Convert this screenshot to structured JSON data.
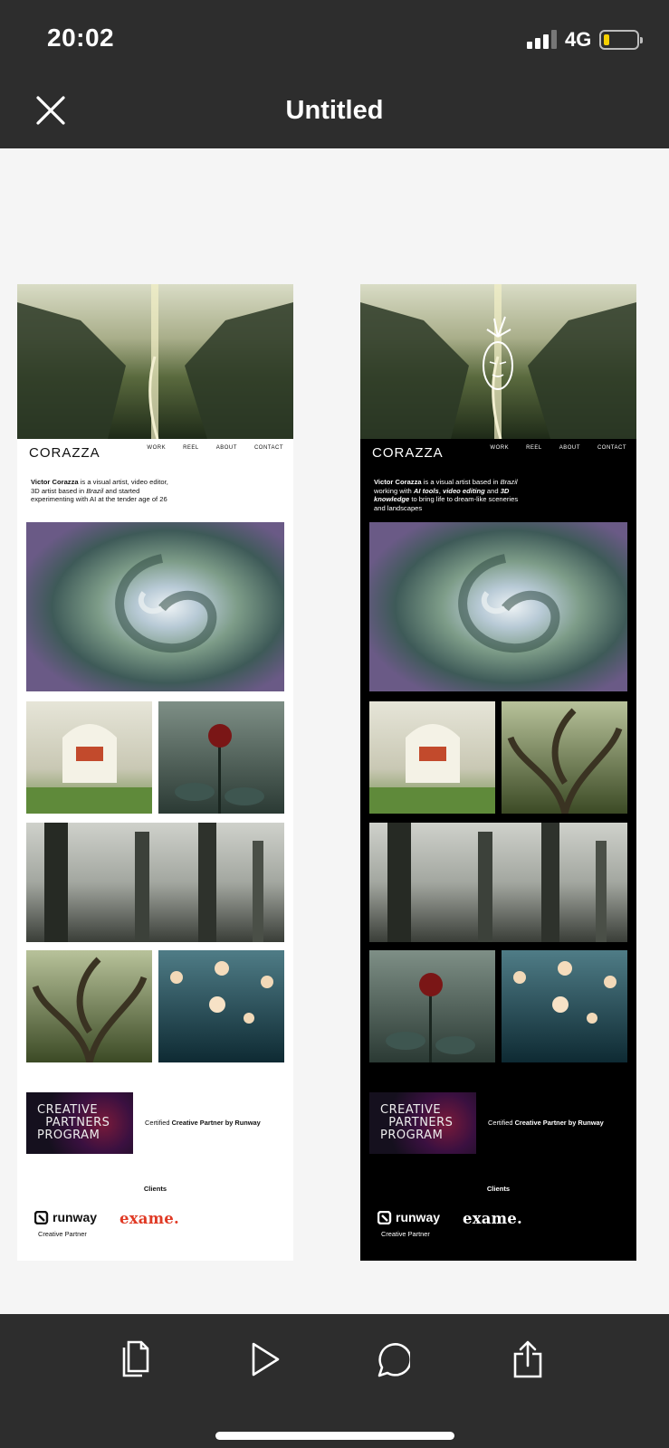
{
  "status_bar": {
    "time": "20:02",
    "network": "4G",
    "battery_color": "#f5d000"
  },
  "nav": {
    "title": "Untitled",
    "close_icon": "close-icon"
  },
  "pages": {
    "light": {
      "brand": "CORAZZA",
      "menu": [
        "WORK",
        "REEL",
        "ABOUT",
        "CONTACT"
      ],
      "bio": {
        "name": "Victor Corazza",
        "t1": " is a visual artist, video editor, 3D artist based in ",
        "country": "Brazil",
        "t2": " and started experimenting with AI at the tender age of 26"
      },
      "partner_box": "CREATIVE\n  PARTNERS\nPROGRAM",
      "cert_prefix": "Certified ",
      "cert_bold": "Creative Partner by Runway",
      "clients_title": "Clients",
      "runway_name": "runway",
      "runway_sub": "Creative Partner",
      "exame": "exame."
    },
    "dark": {
      "brand": "CORAZZA",
      "menu": [
        "WORK",
        "REEL",
        "ABOUT",
        "CONTACT"
      ],
      "bio": {
        "name": "Victor Corazza",
        "t1": " is a visual artist based in ",
        "country": "Brazil",
        "t2": " working with ",
        "b1": "AI tools",
        "t3": ", ",
        "b2": "video editing",
        "t4": " and ",
        "b3": "3D knowledge",
        "t5": " to bring life to dream-like sceneries and landscapes"
      },
      "partner_box": "CREATIVE\n  PARTNERS\nPROGRAM",
      "cert_prefix": "Certified ",
      "cert_bold": "Creative Partner by Runway",
      "clients_title": "Clients",
      "runway_name": "runway",
      "runway_sub": "Creative Partner",
      "exame": "exame."
    }
  },
  "toolbar": {
    "icons": [
      "copy-icon",
      "play-icon",
      "comment-icon",
      "share-icon"
    ]
  },
  "colors": {
    "chrome": "#2d2d2d",
    "canvas": "#f5f5f5",
    "exame_red": "#e03a25"
  }
}
